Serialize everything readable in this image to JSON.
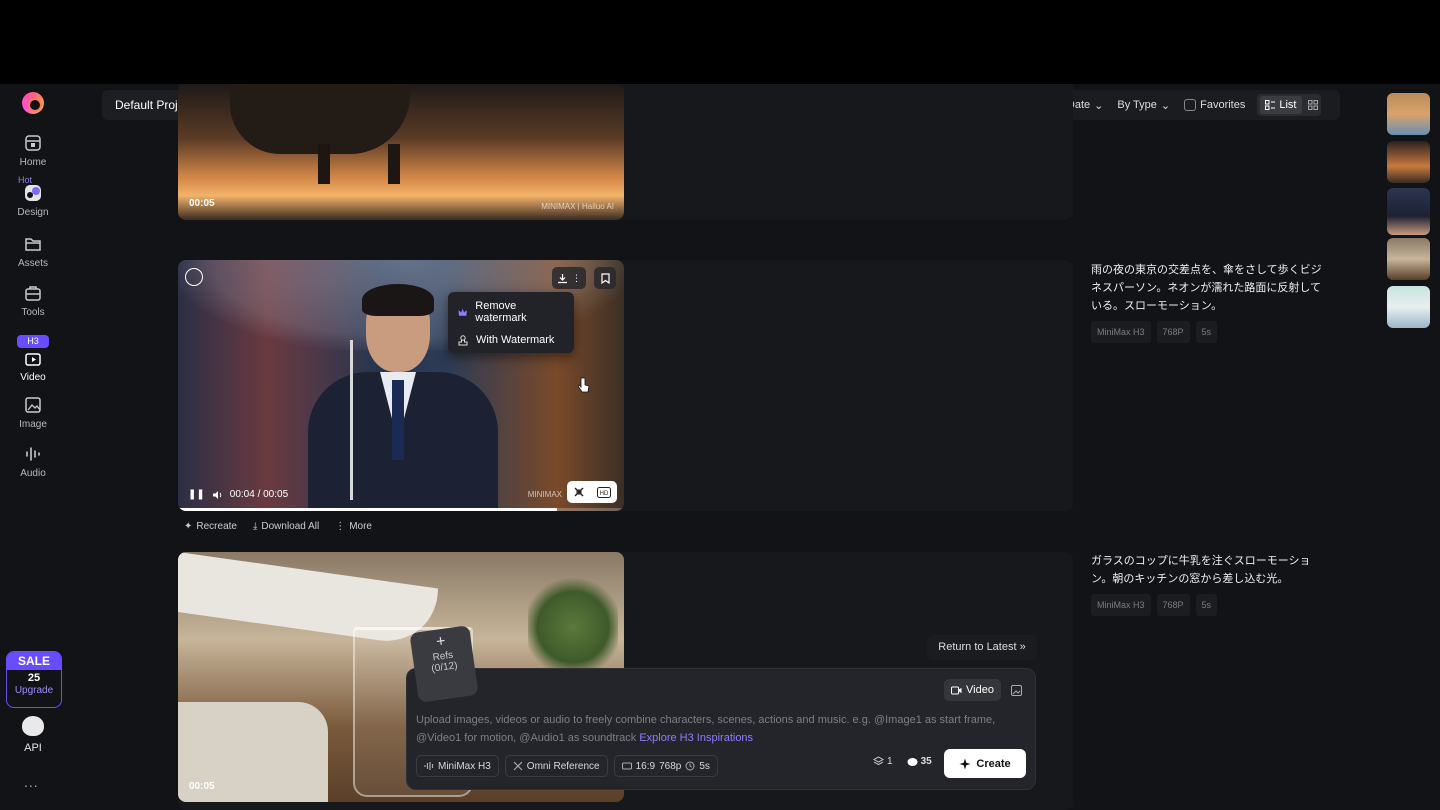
{
  "sidebar": {
    "items": [
      {
        "label": "Home",
        "icon": "home-icon"
      },
      {
        "label": "Design",
        "icon": "design-icon",
        "badge": "Hot"
      },
      {
        "label": "Assets",
        "icon": "folder-icon"
      },
      {
        "label": "Tools",
        "icon": "tools-icon"
      },
      {
        "label": "Video",
        "icon": "video-icon",
        "badge": "H3"
      },
      {
        "label": "Image",
        "icon": "image-icon"
      },
      {
        "label": "Audio",
        "icon": "audio-icon"
      }
    ],
    "sale": {
      "tag": "SALE",
      "number": "25",
      "cta": "Upgrade"
    },
    "api": "API",
    "more": "..."
  },
  "header": {
    "project": "Default Project",
    "filters": {
      "by_date": "By Date",
      "by_type": "By Type",
      "favorites": "Favorites",
      "list": "List"
    }
  },
  "videos": [
    {
      "time": "00:05",
      "watermark": "MINIMAX | Hailuo AI"
    },
    {
      "player_time": "00:04 / 00:05",
      "watermark": "MINIMAX",
      "progress": 0.85,
      "menu": [
        "Remove watermark",
        "With Watermark"
      ],
      "prompt": "雨の夜の東京の交差点を、傘をさして歩くビジネスパーソン。ネオンが濡れた路面に反射している。スローモーション。",
      "meta": [
        "MiniMax H3",
        "768P",
        "5s"
      ],
      "actions": [
        "Recreate",
        "Download All",
        "More"
      ]
    },
    {
      "time": "00:05",
      "prompt": "ガラスのコップに牛乳を注ぐスローモーション。朝のキッチンの窓から差し込む光。",
      "meta": [
        "MiniMax H3",
        "768P",
        "5s"
      ]
    }
  ],
  "composer": {
    "return_label": "Return to Latest",
    "refs_label": "Refs",
    "refs_count": "(0/12)",
    "mode_video": "Video",
    "placeholder_main": "Upload images, videos or audio to freely combine characters, scenes, actions and music. e.g. @Image1 as start frame, @Video1 for motion, @Audio1 as soundtrack",
    "explore_link": "Explore H3 Inspirations",
    "model": "MiniMax H3",
    "reference": "Omni Reference",
    "ratio": "16:9",
    "resolution": "768p",
    "duration": "5s",
    "count": "1",
    "credits": "35",
    "create": "Create"
  },
  "colors": {
    "accent": "#6a4cff",
    "link": "#8f7dff",
    "background": "#121316"
  }
}
